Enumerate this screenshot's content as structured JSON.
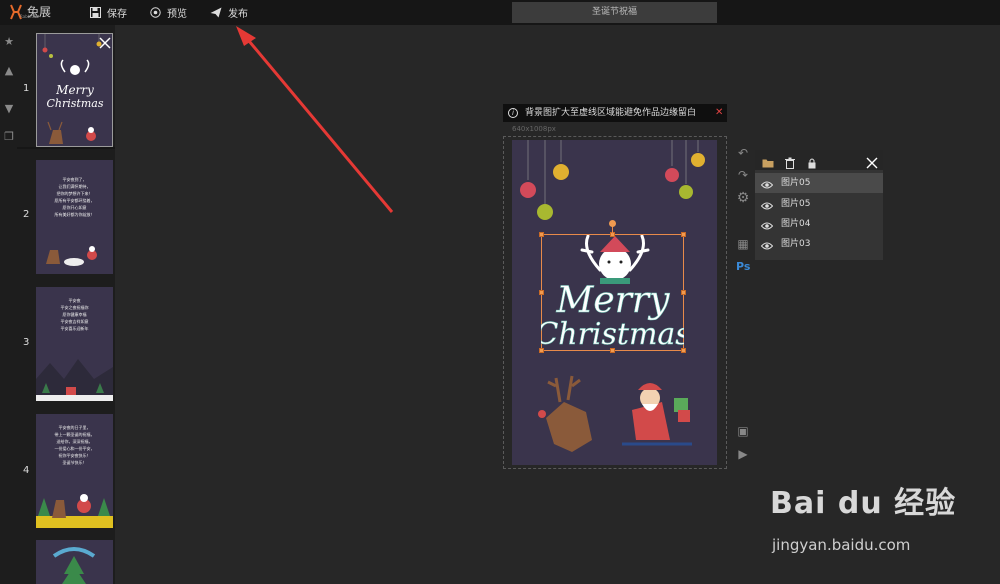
{
  "app": {
    "logo_text": "兔展",
    "logo_sub": "RabbitPre"
  },
  "toolbar": {
    "save_label": "保存",
    "preview_label": "预览",
    "publish_label": "发布",
    "project_title": "圣诞节祝福"
  },
  "pages": {
    "items": [
      {
        "num": "1",
        "text": ""
      },
      {
        "num": "2",
        "text": "平安夜到了，\n让我们满怀期待，\n把你的梦想许下来！\n愿所有平安都环绕着，\n愿你开心如意\n所有美好都为你绽放！"
      },
      {
        "num": "3",
        "text": "平安夜\n平安之夜祝福你\n愿你健康幸福\n平安夜吉祥如意\n平安喜乐迎新年"
      },
      {
        "num": "4",
        "text": "平安夜的日子里，\n带上一颗圣诞的祝福，\n送给你，深深祝福，\n一份爱心和一份平安，\n祝你平安夜快乐！\n圣诞节快乐！"
      },
      {
        "num": "5",
        "text": ""
      }
    ]
  },
  "tooltip": {
    "info": "i",
    "text": "背景图扩大至虚线区域能避免作品边缘留白",
    "close": "✕"
  },
  "canvas": {
    "dims": "640x1008px",
    "headline_1": "Merry",
    "headline_2": "Christmas"
  },
  "layers": {
    "items": [
      "图片05",
      "图片05",
      "图片04",
      "图片03"
    ],
    "active_index": 0
  },
  "watermark": {
    "main": "Bai du 经验",
    "sub": "jingyan.baidu.com"
  },
  "colors": {
    "background": "#272727",
    "panel": "#1d1d1d",
    "topbar": "#161616",
    "canvas_bg": "#3a344c",
    "selection": "#e88a4a",
    "arrow": "#e53935"
  }
}
